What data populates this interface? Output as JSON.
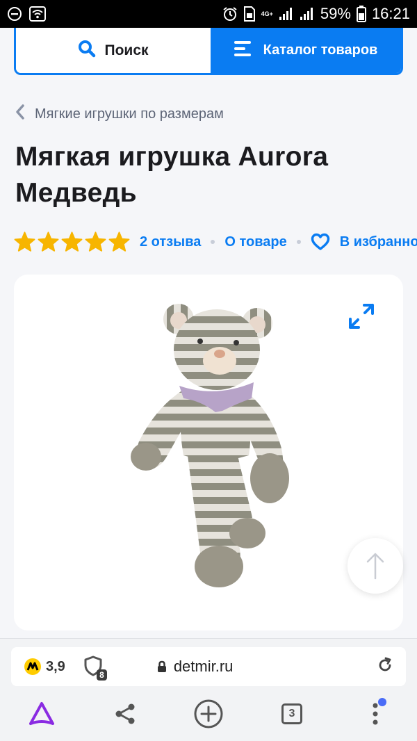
{
  "status_bar": {
    "battery": "59%",
    "time": "16:21",
    "network": "4G+"
  },
  "topbar": {
    "search_label": "Поиск",
    "catalog_label": "Каталог товаров"
  },
  "breadcrumb": {
    "label": "Мягкие игрушки по размерам"
  },
  "product": {
    "title": "Мягкая игрушка Aurora Медведь",
    "rating": 5,
    "reviews_label": "2 отзыва",
    "about_label": "О товаре",
    "favorite_label": "В избранное"
  },
  "browser": {
    "yandex_rating": "3,9",
    "trackers_blocked": "8",
    "url": "detmir.ru",
    "tabs_count": "3"
  },
  "colors": {
    "accent": "#0a7cf2",
    "star": "#f7b500",
    "alice": "#8a2be2"
  },
  "icons": {
    "search": "search-icon",
    "catalog": "menu-icon",
    "back": "chevron-left-icon",
    "favorite": "heart-icon",
    "expand": "expand-icon",
    "scroll_top": "arrow-up-icon"
  }
}
